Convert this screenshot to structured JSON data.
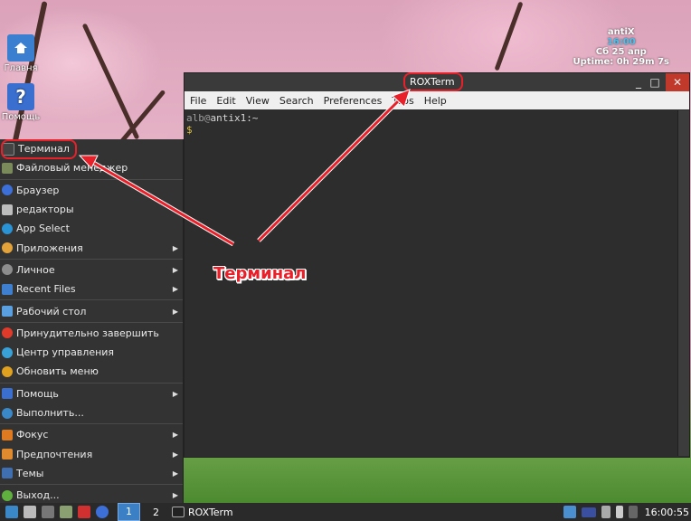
{
  "desktop": {
    "icons": [
      {
        "label": "Главня",
        "icon": "home-folder-icon"
      },
      {
        "label": "Помощь",
        "icon": "help-icon"
      }
    ],
    "conky": {
      "line1": "antiX",
      "line2": "16:00",
      "line3": "Сб 25 апр",
      "line4": "Uptime: 0h 29m 7s"
    }
  },
  "terminal": {
    "title": "ROXTerm",
    "buttons": {
      "minimize": "_",
      "maximize": "□",
      "close": "✕"
    },
    "menu": [
      "File",
      "Edit",
      "View",
      "Search",
      "Preferences",
      "Tabs",
      "Help"
    ],
    "prompt": {
      "user": "alb",
      "at": "@",
      "host": "antix1",
      "path": ":~",
      "symbol": "$"
    }
  },
  "start_menu": {
    "items": [
      {
        "label": "Терминал",
        "icon": "terminal-icon",
        "color": "#444444",
        "submenu": false
      },
      {
        "label": "Файловый менеджер",
        "icon": "file-manager-icon",
        "color": "#7a8a5a",
        "submenu": false
      },
      {
        "label": "Браузер",
        "icon": "browser-icon",
        "color": "#3d6fd8",
        "submenu": false
      },
      {
        "label": "редакторы",
        "icon": "editor-icon",
        "color": "#bdbdbd",
        "submenu": false
      },
      {
        "label": "App Select",
        "icon": "app-select-icon",
        "color": "#2a93d5",
        "submenu": false
      },
      {
        "label": "Приложения",
        "icon": "applications-icon",
        "color": "#e3a33a",
        "submenu": true
      },
      {
        "label": "Личное",
        "icon": "personal-icon",
        "color": "#8d8d8d",
        "submenu": true
      },
      {
        "label": "Recent Files",
        "icon": "recent-files-icon",
        "color": "#3f7fd0",
        "submenu": true
      },
      {
        "label": "Рабочий стол",
        "icon": "desktop-icon",
        "color": "#5aa0e0",
        "submenu": true
      },
      {
        "label": "Принудительно завершить",
        "icon": "force-quit-icon",
        "color": "#e03a2a",
        "submenu": false
      },
      {
        "label": "Центр управления",
        "icon": "control-center-icon",
        "color": "#3aa0d8",
        "submenu": false
      },
      {
        "label": "Обновить меню",
        "icon": "refresh-menu-icon",
        "color": "#e0a020",
        "submenu": false
      },
      {
        "label": "Помощь",
        "icon": "help-menu-icon",
        "color": "#3a6fd0",
        "submenu": true
      },
      {
        "label": "Выполнить...",
        "icon": "run-icon",
        "color": "#3a88c8",
        "submenu": false
      },
      {
        "label": "Фокус",
        "icon": "focus-icon",
        "color": "#e07a20",
        "submenu": true
      },
      {
        "label": "Предпочтения",
        "icon": "preferences-icon",
        "color": "#e08a30",
        "submenu": true
      },
      {
        "label": "Темы",
        "icon": "themes-icon",
        "color": "#3f6fb0",
        "submenu": true
      },
      {
        "label": "Выход...",
        "icon": "exit-icon",
        "color": "#60b040",
        "submenu": true
      }
    ]
  },
  "taskbar": {
    "workspace1": "1",
    "workspace2": "2",
    "task_label": "ROXTerm",
    "clock": "16:00:55",
    "colors": {
      "bg": "#2a2a2a",
      "active_ws": "#3b7fc4"
    }
  },
  "annotation": {
    "label": "Терминал",
    "color": "#e8202a"
  }
}
